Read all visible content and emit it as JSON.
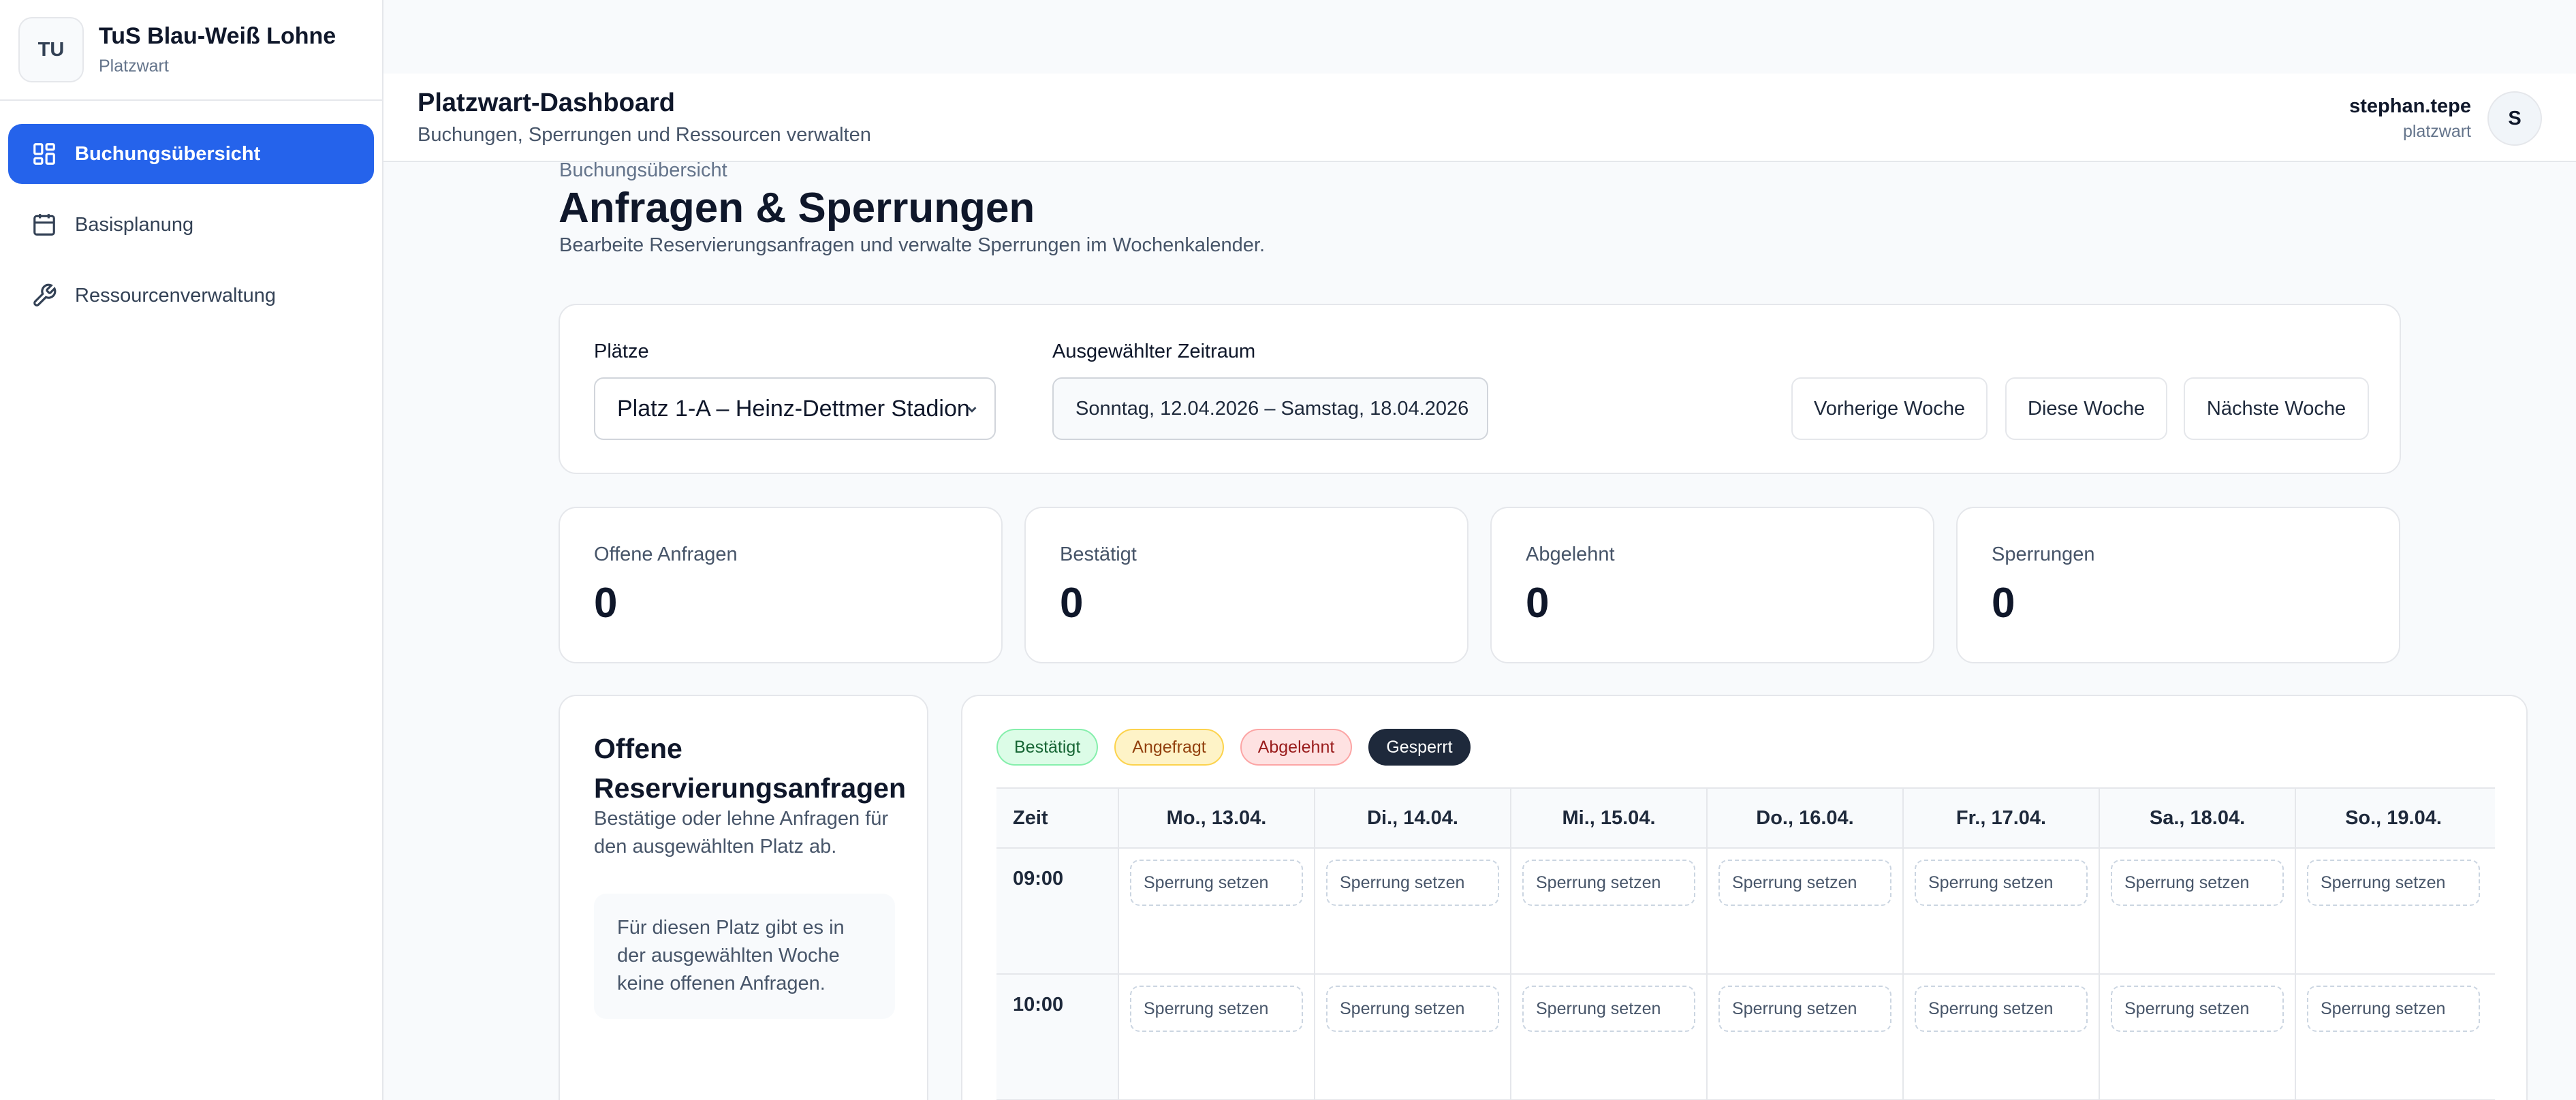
{
  "sidebar": {
    "logo_initials": "TU",
    "club_name": "TuS Blau-Weiß Lohne",
    "role": "Platzwart",
    "items": [
      {
        "label": "Buchungsübersicht",
        "icon": "dashboard-icon",
        "active": true
      },
      {
        "label": "Basisplanung",
        "icon": "calendar-icon",
        "active": false
      },
      {
        "label": "Ressourcenverwaltung",
        "icon": "wrench-icon",
        "active": false
      }
    ]
  },
  "header": {
    "title": "Platzwart-Dashboard",
    "subtitle": "Buchungen, Sperrungen und Ressourcen verwalten",
    "user_name": "stephan.tepe",
    "user_role": "platzwart",
    "avatar_initial": "S"
  },
  "page": {
    "breadcrumb": "Buchungsübersicht",
    "title": "Anfragen & Sperrungen",
    "description": "Bearbeite Reservierungsanfragen und verwalte Sperrungen im Wochenkalender."
  },
  "filters": {
    "places_label": "Plätze",
    "place_selected": "Platz 1-A – Heinz-Dettmer Stadion",
    "range_label": "Ausgewählter Zeitraum",
    "range_value": "Sonntag, 12.04.2026 – Samstag, 18.04.2026",
    "prev_week": "Vorherige Woche",
    "this_week": "Diese Woche",
    "next_week": "Nächste Woche"
  },
  "stats": [
    {
      "label": "Offene Anfragen",
      "value": "0"
    },
    {
      "label": "Bestätigt",
      "value": "0"
    },
    {
      "label": "Abgelehnt",
      "value": "0"
    },
    {
      "label": "Sperrungen",
      "value": "0"
    }
  ],
  "requests": {
    "title": "Offene Reservierungsanfragen",
    "subtitle": "Bestätige oder lehne Anfragen für den ausgewählten Platz ab.",
    "empty": "Für diesen Platz gibt es in der ausgewählten Woche keine offenen Anfragen."
  },
  "calendar": {
    "legend": [
      {
        "label": "Bestätigt",
        "bg": "#dcfce7",
        "border": "#86efac",
        "color": "#166534"
      },
      {
        "label": "Angefragt",
        "bg": "#fef3c7",
        "border": "#fcd34d",
        "color": "#92400e"
      },
      {
        "label": "Abgelehnt",
        "bg": "#fee2e2",
        "border": "#fca5a5",
        "color": "#991b1b"
      },
      {
        "label": "Gesperrt",
        "bg": "#1e293b",
        "border": "#1e293b",
        "color": "#ffffff"
      }
    ],
    "time_header": "Zeit",
    "days": [
      "Mo., 13.04.",
      "Di., 14.04.",
      "Mi., 15.04.",
      "Do., 16.04.",
      "Fr., 17.04.",
      "Sa., 18.04.",
      "So., 19.04."
    ],
    "rows": [
      "09:00",
      "10:00"
    ],
    "slot_label": "Sperrung setzen"
  }
}
